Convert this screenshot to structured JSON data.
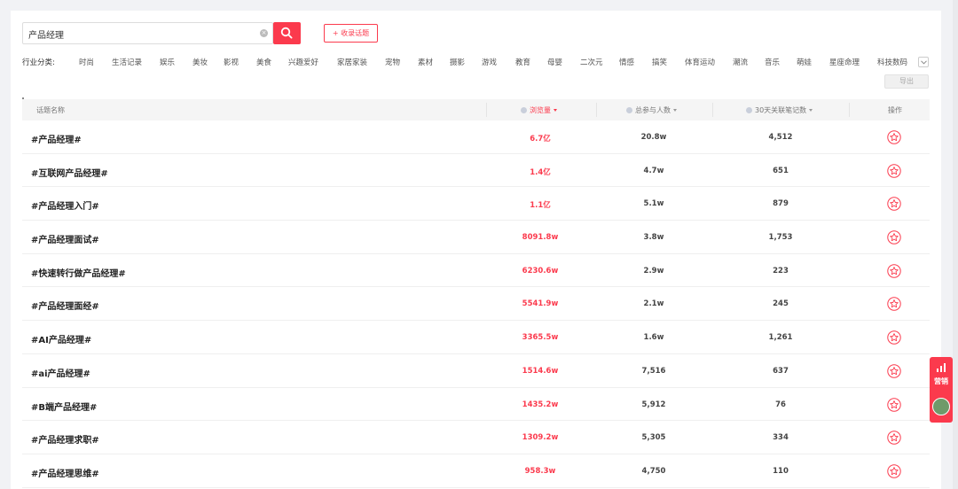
{
  "search": {
    "value": "产品经理",
    "clear_icon": "clear-icon",
    "button_icon": "search-icon"
  },
  "toolbar": {
    "favorite_label": "+ 收录话题",
    "export_label": "导出"
  },
  "categories": {
    "label": "行业分类:",
    "items": [
      "时尚",
      "生活记录",
      "娱乐",
      "美妆",
      "影视",
      "美食",
      "兴趣爱好",
      "家居家装",
      "宠物",
      "素材",
      "摄影",
      "游戏",
      "教育",
      "母婴",
      "二次元",
      "情感",
      "搞笑",
      "体育运动",
      "潮流",
      "音乐",
      "萌娃",
      "星座命理",
      "科技数码"
    ]
  },
  "table": {
    "headers": {
      "name": "话题名称",
      "views": "浏览量",
      "participants": "总参与人数",
      "notes": "30天关联笔记数",
      "action": "操作"
    },
    "rows": [
      {
        "name": "#产品经理#",
        "views": "6.7亿",
        "participants": "20.8w",
        "notes": "4,512"
      },
      {
        "name": "#互联网产品经理#",
        "views": "1.4亿",
        "participants": "4.7w",
        "notes": "651"
      },
      {
        "name": "#产品经理入门#",
        "views": "1.1亿",
        "participants": "5.1w",
        "notes": "879"
      },
      {
        "name": "#产品经理面试#",
        "views": "8091.8w",
        "participants": "3.8w",
        "notes": "1,753"
      },
      {
        "name": "#快速转行做产品经理#",
        "views": "6230.6w",
        "participants": "2.9w",
        "notes": "223"
      },
      {
        "name": "#产品经理面经#",
        "views": "5541.9w",
        "participants": "2.1w",
        "notes": "245"
      },
      {
        "name": "#AI产品经理#",
        "views": "3365.5w",
        "participants": "1.6w",
        "notes": "1,261"
      },
      {
        "name": "#ai产品经理#",
        "views": "1514.6w",
        "participants": "7,516",
        "notes": "637"
      },
      {
        "name": "#B端产品经理#",
        "views": "1435.2w",
        "participants": "5,912",
        "notes": "76"
      },
      {
        "name": "#产品经理求职#",
        "views": "1309.2w",
        "participants": "5,305",
        "notes": "334"
      },
      {
        "name": "#产品经理思维#",
        "views": "958.3w",
        "participants": "4,750",
        "notes": "110"
      }
    ]
  },
  "side_widget": {
    "label": "营销"
  },
  "colors": {
    "accent": "#fb3a4d"
  }
}
